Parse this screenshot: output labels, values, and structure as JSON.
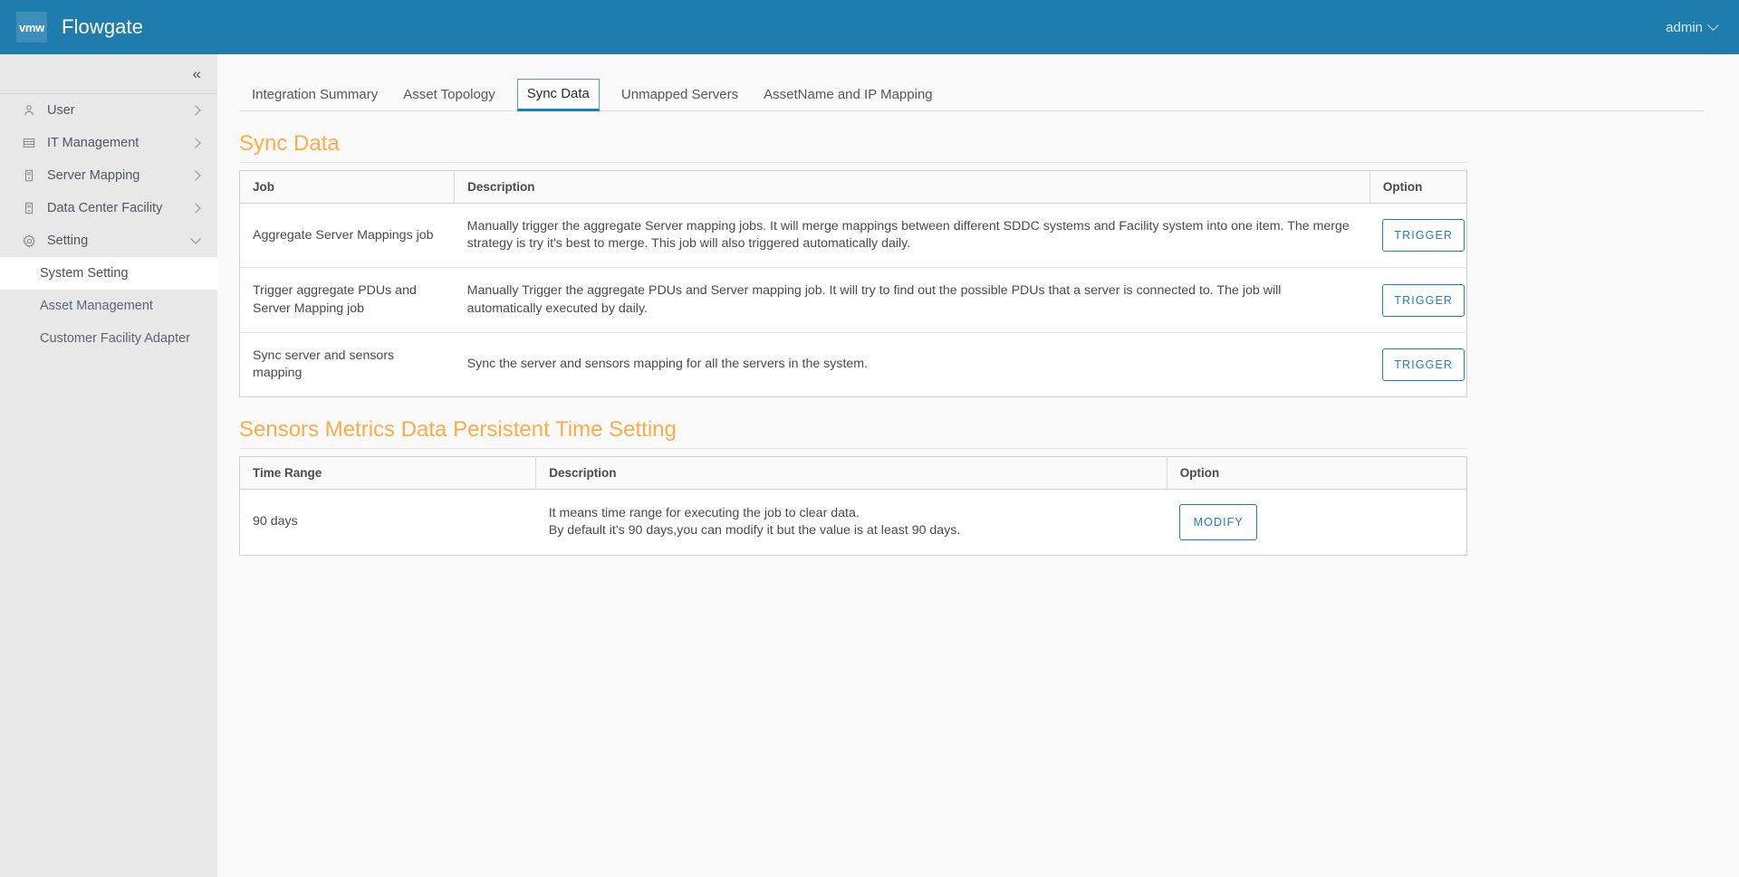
{
  "topbar": {
    "logo_text": "vmw",
    "logo_icon": "vmware-logo-icon",
    "title": "Flowgate",
    "user": "admin",
    "user_caret_icon": "chevron-down-icon",
    "bg_color": "#1f7dad"
  },
  "sidebar": {
    "collapse_icon": "«",
    "items": [
      {
        "label": "User",
        "icon": "user-icon",
        "arrow": "chevron-right-icon",
        "expanded": false
      },
      {
        "label": "IT Management",
        "icon": "list-icon",
        "arrow": "chevron-right-icon",
        "expanded": false
      },
      {
        "label": "Server Mapping",
        "icon": "server-icon",
        "arrow": "chevron-right-icon",
        "expanded": false
      },
      {
        "label": "Data Center Facility",
        "icon": "rack-icon",
        "arrow": "chevron-right-icon",
        "expanded": false
      },
      {
        "label": "Setting",
        "icon": "gear-icon",
        "arrow": "chevron-down-icon",
        "expanded": true
      }
    ],
    "sub_items": [
      {
        "label": "System Setting",
        "active": true
      },
      {
        "label": "Asset Management",
        "active": false
      },
      {
        "label": "Customer Facility Adapter",
        "active": false
      }
    ]
  },
  "tabs": [
    {
      "label": "Integration Summary",
      "active": false
    },
    {
      "label": "Asset Topology",
      "active": false
    },
    {
      "label": "Sync Data",
      "active": true
    },
    {
      "label": "Unmapped Servers",
      "active": false
    },
    {
      "label": "AssetName and IP Mapping",
      "active": false
    }
  ],
  "sync_data_section": {
    "title": "Sync Data",
    "columns": [
      "Job",
      "Description",
      "Option"
    ],
    "rows": [
      {
        "job": "Aggregate Server Mappings job",
        "description": "Manually trigger the aggregate Server mapping jobs. It will merge mappings between different SDDC systems and Facility system into one item. The merge strategy is try it's best to merge. This job will also triggered automatically daily.",
        "action": "TRIGGER"
      },
      {
        "job": "Trigger aggregate PDUs and Server Mapping job",
        "description": "Manually Trigger the aggregate PDUs and Server mapping job. It will try to find out the possible PDUs that a server is connected to. The job will automatically executed by daily.",
        "action": "TRIGGER"
      },
      {
        "job": "Sync server and sensors mapping",
        "description": "Sync the server and sensors mapping for all the servers in the system.",
        "action": "TRIGGER"
      }
    ]
  },
  "persist_section": {
    "title": "Sensors Metrics Data Persistent Time Setting",
    "columns": [
      "Time Range",
      "Description",
      "Option"
    ],
    "rows": [
      {
        "time_range": "90 days",
        "description_line1": "It means time range for executing the job to clear data.",
        "description_line2": "By default it's 90 days,you can modify it but the value is at least 90 days.",
        "action": "MODIFY"
      }
    ]
  },
  "colors": {
    "accent_blue": "#1b7ec1",
    "heading_orange": "#fcab49",
    "sidebar_bg": "#e8e8e8"
  }
}
